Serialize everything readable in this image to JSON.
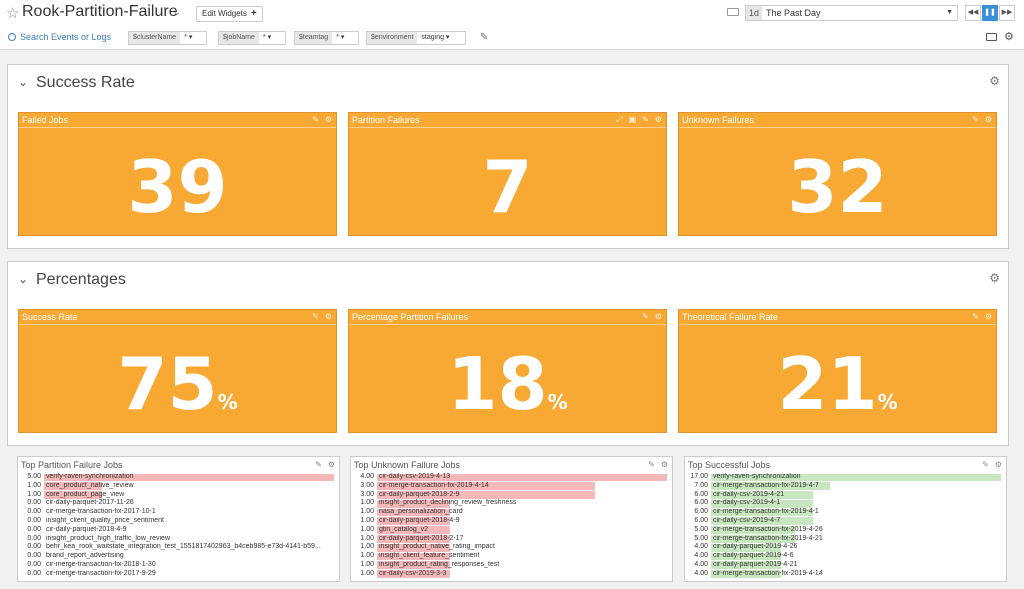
{
  "header": {
    "title": "Rook-Partition-Failure",
    "edit_widgets": "Edit Widgets",
    "time_code": "1d",
    "time_label": "The Past Day"
  },
  "filters": {
    "search_label": "Search Events or Logs",
    "vars": [
      {
        "name": "$clusterName",
        "value": "*"
      },
      {
        "name": "$jobName",
        "value": "*"
      },
      {
        "name": "$teamtag",
        "value": "*"
      },
      {
        "name": "$environment",
        "value": "staging"
      }
    ]
  },
  "groups": [
    {
      "title": "Success Rate",
      "widgets": [
        {
          "title": "Failed Jobs",
          "value": "39",
          "unit": ""
        },
        {
          "title": "Partition Failures",
          "value": "7",
          "unit": ""
        },
        {
          "title": "Unknown Failures",
          "value": "32",
          "unit": ""
        }
      ]
    },
    {
      "title": "Percentages",
      "widgets": [
        {
          "title": "Success Rate",
          "value": "75",
          "unit": "%"
        },
        {
          "title": "Percentage Partition Failures",
          "value": "18",
          "unit": "%"
        },
        {
          "title": "Theoretical Failure Rate",
          "value": "21",
          "unit": "%"
        }
      ]
    }
  ],
  "toplists": [
    {
      "title": "Top Partition Failure Jobs",
      "bar_color": "#f5b8b8",
      "rows": [
        {
          "value": "5.00",
          "name": "verify-raven-synchronization",
          "fraction": 1.0
        },
        {
          "value": "1.00",
          "name": "core_product_native_review",
          "fraction": 0.2
        },
        {
          "value": "1.00",
          "name": "core_product_page_view",
          "fraction": 0.2
        },
        {
          "value": "0.00",
          "name": "cir-daily-parquet-2017-11-26",
          "fraction": 0
        },
        {
          "value": "0.00",
          "name": "cir-merge-transaction-fix-2017-10-1",
          "fraction": 0
        },
        {
          "value": "0.00",
          "name": "insight_client_quality_price_sentiment",
          "fraction": 0
        },
        {
          "value": "0.00",
          "name": "cir-daily-parquet-2018-4-9",
          "fraction": 0
        },
        {
          "value": "0.00",
          "name": "insight_product_high_traffic_low_review",
          "fraction": 0
        },
        {
          "value": "0.00",
          "name": "behr_kea_rook_waitstate_integration_test_1551817402963_b4ceb985-e73d-4141-b59...",
          "fraction": 0
        },
        {
          "value": "0.00",
          "name": "brand_report_advertising",
          "fraction": 0
        },
        {
          "value": "0.00",
          "name": "cir-merge-transaction-fix-2018-1-30",
          "fraction": 0
        },
        {
          "value": "0.00",
          "name": "cir-merge-transaction-fix-2017-9-29",
          "fraction": 0
        }
      ]
    },
    {
      "title": "Top Unknown Failure Jobs",
      "bar_color": "#f5b8b8",
      "rows": [
        {
          "value": "4.00",
          "name": "cir-daily-csv-2019-4-13",
          "fraction": 1.0
        },
        {
          "value": "3.00",
          "name": "cir-merge-transaction-fix-2019-4-14",
          "fraction": 0.75
        },
        {
          "value": "3.00",
          "name": "cir-daily-parquet-2018-2-9",
          "fraction": 0.75
        },
        {
          "value": "1.00",
          "name": "insight_product_declining_review_freshness",
          "fraction": 0.25
        },
        {
          "value": "1.00",
          "name": "nasa_personalization_card",
          "fraction": 0.25
        },
        {
          "value": "1.00",
          "name": "cir-daily-parquet-2018-4-9",
          "fraction": 0.25
        },
        {
          "value": "1.00",
          "name": "gtin_catalog_v2",
          "fraction": 0.25
        },
        {
          "value": "1.00",
          "name": "cir-daily-parquet-2018-2-17",
          "fraction": 0.25
        },
        {
          "value": "1.00",
          "name": "insight_product_native_rating_impact",
          "fraction": 0.25
        },
        {
          "value": "1.00",
          "name": "insight_client_feature_sentiment",
          "fraction": 0.25
        },
        {
          "value": "1.00",
          "name": "insight_product_rating_responses_test",
          "fraction": 0.25
        },
        {
          "value": "1.00",
          "name": "cir-daily-csv-2019-3-3",
          "fraction": 0.25
        }
      ]
    },
    {
      "title": "Top Successful Jobs",
      "bar_color": "#c8e6c0",
      "rows": [
        {
          "value": "17.00",
          "name": "verify-raven-synchronization",
          "fraction": 1.0
        },
        {
          "value": "7.00",
          "name": "cir-merge-transaction-fix-2019-4-7",
          "fraction": 0.41
        },
        {
          "value": "6.00",
          "name": "cir-daily-csv-2019-4-21",
          "fraction": 0.35
        },
        {
          "value": "6.00",
          "name": "cir-daily-csv-2019-4-1",
          "fraction": 0.35
        },
        {
          "value": "6.00",
          "name": "cir-merge-transaction-fix-2019-4-1",
          "fraction": 0.35
        },
        {
          "value": "6.00",
          "name": "cir-daily-csv-2019-4-7",
          "fraction": 0.35
        },
        {
          "value": "5.00",
          "name": "cir-merge-transaction-fix-2019-4-26",
          "fraction": 0.29
        },
        {
          "value": "5.00",
          "name": "cir-merge-transaction-fix-2019-4-21",
          "fraction": 0.29
        },
        {
          "value": "4.00",
          "name": "cir-daily-parquet-2019-4-26",
          "fraction": 0.24
        },
        {
          "value": "4.00",
          "name": "cir-daily-parquet-2019-4-6",
          "fraction": 0.24
        },
        {
          "value": "4.00",
          "name": "cir-daily-parquet-2019-4-21",
          "fraction": 0.24
        },
        {
          "value": "4.00",
          "name": "cir-merge-transaction-fix-2019-4-14",
          "fraction": 0.24
        }
      ]
    }
  ]
}
